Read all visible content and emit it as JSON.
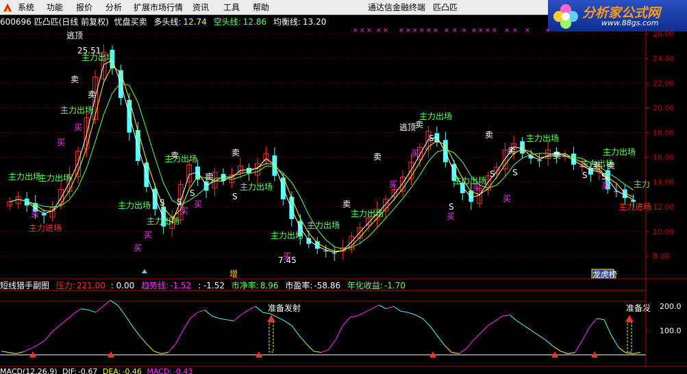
{
  "menu": {
    "items": [
      "系统",
      "功能",
      "报价",
      "分析",
      "扩展市场行情",
      "资讯",
      "工具",
      "帮助"
    ],
    "window_title": "通达信金融终端",
    "stock_short": "匹凸匹"
  },
  "logo": {
    "brand": "分析家公式网",
    "url": "www.88gs.com"
  },
  "header": {
    "code_name": "600696 匹凸匹(日线 前复权)",
    "indicator_name": "忧盘买卖",
    "ma_bull_label": "多头线:",
    "ma_bull_value": "12.74",
    "ma_bear_label": "空头线:",
    "ma_bear_value": "12.86",
    "ma_avg_label": "均衡线:",
    "ma_avg_value": "13.20"
  },
  "sub_indicator": {
    "name": "短线猎手副图",
    "pressure_label": "压力:",
    "pressure_value": "221.00",
    "extra_value": ": 0.00",
    "trend_label": "趋势线:",
    "trend_value": "-1.52",
    "trend_value2": ": -1.52",
    "pb_label": "市净率:",
    "pb_value": "8.96",
    "pe_label": "市盈率:",
    "pe_value": "-58.86",
    "annual_label": "年化收益:",
    "annual_value": "-1.70"
  },
  "macd_line": {
    "name": "MACD(12,26,9)",
    "dif_label": "DIF:",
    "dif_value": "-0.67",
    "dea_label": "DEA:",
    "dea_value": "-0.46",
    "macd_label": "MACD:",
    "macd_value": "-0.43"
  },
  "chart_labels": {
    "escape_top": "逃顶",
    "escape_top2": "逃顶",
    "high_price": "25.51",
    "low_price": "7.45",
    "main_exit": "主力出场",
    "main_enter": "主力进场",
    "sell": "卖",
    "buy": "买",
    "s": "S",
    "prepare_launch": "准备发射",
    "prepare_launch_short": "准备发",
    "increase_tag": "增",
    "dragon_tag": "龙虎榜",
    "main_exit_cut": "主力"
  },
  "colors": {
    "up": "#ff3030",
    "down": "#54ffff",
    "yellow": "#ffff00",
    "magenta": "#ff30ff",
    "green_label": "#66ff66",
    "grid": "#a00000",
    "axis": "#c00000"
  },
  "chart_data": [
    {
      "type": "candlestick",
      "title": "600696 匹凸匹(日线 前复权)",
      "ylabel": "",
      "yticks": [
        8.0,
        10.0,
        12.0,
        14.0,
        16.0,
        18.0,
        20.0,
        22.0,
        24.0,
        26.0
      ],
      "ylim": [
        7.0,
        26.4
      ],
      "approx_close": [
        12.4,
        12.8,
        12.1,
        11.6,
        11.3,
        12.0,
        13.4,
        14.6,
        16.5,
        19.2,
        22.5,
        24.5,
        23.2,
        20.8,
        18.0,
        15.7,
        13.6,
        11.8,
        10.4,
        11.1,
        13.8,
        15.4,
        14.2,
        13.3,
        14.8,
        14.1,
        14.6,
        15.3,
        14.7,
        15.5,
        16.3,
        14.5,
        12.6,
        11.0,
        9.6,
        9.0,
        8.6,
        8.4,
        8.2,
        8.7,
        9.6,
        10.3,
        11.1,
        11.8,
        12.6,
        13.4,
        14.4,
        15.6,
        16.8,
        18.1,
        17.2,
        15.6,
        14.1,
        13.1,
        12.4,
        13.5,
        14.5,
        15.2,
        16.6,
        17.1,
        16.3,
        15.9,
        15.7,
        16.6,
        16.2,
        16.1,
        15.4,
        15.3,
        14.6,
        15.1,
        13.4,
        13.2,
        12.7,
        12.4
      ],
      "high": 25.51,
      "low": 7.45
    },
    {
      "type": "line",
      "title": "短线猎手副图",
      "yticks": [
        100.0,
        200.0
      ],
      "approx_values": [
        15,
        10,
        5,
        12,
        25,
        40,
        60,
        95,
        120,
        145,
        170,
        190,
        185,
        175,
        200,
        225,
        205,
        165,
        120,
        80,
        45,
        15,
        5,
        10,
        45,
        100,
        150,
        175,
        185,
        160,
        150,
        145,
        140,
        165,
        185,
        200,
        175,
        170,
        155,
        140,
        120,
        80,
        45,
        15,
        10,
        20,
        60,
        120,
        155,
        160,
        175,
        190,
        205,
        190,
        200,
        180,
        175,
        165,
        150,
        120,
        80,
        40,
        10,
        5,
        25,
        60,
        90,
        120,
        140,
        160,
        165,
        140,
        120,
        100,
        80,
        60,
        35,
        15,
        5,
        10,
        60,
        115,
        150,
        145,
        80,
        30,
        8,
        5,
        10
      ]
    }
  ]
}
